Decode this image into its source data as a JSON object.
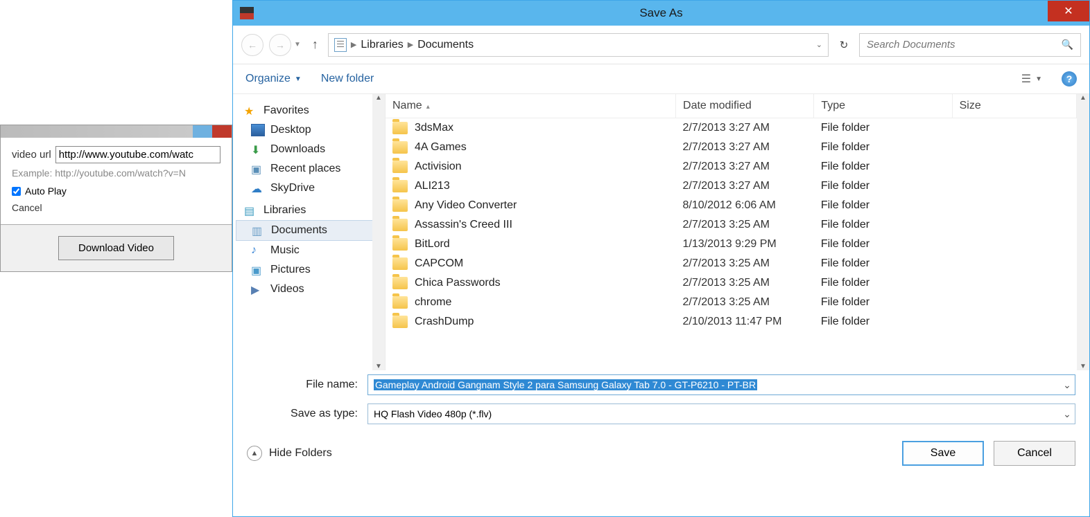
{
  "bgApp": {
    "videoUrlLabel": "video url",
    "videoUrlValue": "http://www.youtube.com/watc",
    "exampleText": "Example: http://youtube.com/watch?v=N",
    "autoPlayLabel": "Auto Play",
    "cancelLabel": "Cancel",
    "downloadBtn": "Download Video"
  },
  "dialog": {
    "title": "Save As",
    "breadcrumb": {
      "seg1": "Libraries",
      "seg2": "Documents"
    },
    "searchPlaceholder": "Search Documents",
    "toolbar": {
      "organize": "Organize",
      "newFolder": "New folder"
    },
    "tree": {
      "favorites": "Favorites",
      "desktop": "Desktop",
      "downloads": "Downloads",
      "recent": "Recent places",
      "skydrive": "SkyDrive",
      "libraries": "Libraries",
      "documents": "Documents",
      "music": "Music",
      "pictures": "Pictures",
      "videos": "Videos"
    },
    "columns": {
      "name": "Name",
      "date": "Date modified",
      "type": "Type",
      "size": "Size"
    },
    "rows": [
      {
        "name": "3dsMax",
        "date": "2/7/2013 3:27 AM",
        "type": "File folder"
      },
      {
        "name": "4A Games",
        "date": "2/7/2013 3:27 AM",
        "type": "File folder"
      },
      {
        "name": "Activision",
        "date": "2/7/2013 3:27 AM",
        "type": "File folder"
      },
      {
        "name": "ALI213",
        "date": "2/7/2013 3:27 AM",
        "type": "File folder"
      },
      {
        "name": "Any Video Converter",
        "date": "8/10/2012 6:06 AM",
        "type": "File folder"
      },
      {
        "name": "Assassin's Creed III",
        "date": "2/7/2013 3:25 AM",
        "type": "File folder"
      },
      {
        "name": "BitLord",
        "date": "1/13/2013 9:29 PM",
        "type": "File folder"
      },
      {
        "name": "CAPCOM",
        "date": "2/7/2013 3:25 AM",
        "type": "File folder"
      },
      {
        "name": "Chica Passwords",
        "date": "2/7/2013 3:25 AM",
        "type": "File folder"
      },
      {
        "name": "chrome",
        "date": "2/7/2013 3:25 AM",
        "type": "File folder"
      },
      {
        "name": "CrashDump",
        "date": "2/10/2013 11:47 PM",
        "type": "File folder"
      }
    ],
    "form": {
      "fileNameLabel": "File name:",
      "fileNameValue": "Gameplay Android Gangnam Style 2 para Samsung Galaxy Tab 7.0 - GT-P6210 - PT-BR",
      "saveTypeLabel": "Save as type:",
      "saveTypeValue": "HQ Flash Video 480p (*.flv)"
    },
    "footer": {
      "hideFolders": "Hide Folders",
      "save": "Save",
      "cancel": "Cancel"
    }
  }
}
